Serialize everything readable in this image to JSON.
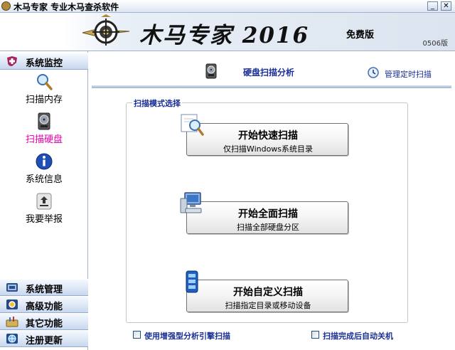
{
  "window": {
    "title": "木马专家  专业木马查杀软件",
    "controls": {
      "minimize": "_",
      "close": "✕"
    }
  },
  "banner": {
    "brand": "木马专家 2016",
    "edition": "免费版",
    "version": "0506版"
  },
  "sidebar": {
    "groups": [
      {
        "label": "系统监控",
        "icon": "shield-cross-icon",
        "expanded": true
      },
      {
        "label": "系统管理",
        "icon": "system-manage-icon"
      },
      {
        "label": "高级功能",
        "icon": "advanced-gear-icon"
      },
      {
        "label": "其它功能",
        "icon": "toolbox-icon"
      },
      {
        "label": "注册更新",
        "icon": "globe-icon"
      }
    ],
    "items": [
      {
        "label": "扫描内存",
        "icon": "magnifier-icon",
        "active": false
      },
      {
        "label": "扫描硬盘",
        "icon": "hard-disk-icon",
        "active": true
      },
      {
        "label": "系统信息",
        "icon": "info-icon",
        "active": false
      },
      {
        "label": "我要举报",
        "icon": "report-upload-icon",
        "active": false
      }
    ]
  },
  "main": {
    "header_title": "硬盘扫描分析",
    "schedule_link": "管理定时扫描",
    "mode_group_label": "扫描模式选择",
    "buttons": [
      {
        "title": "开始快速扫描",
        "subtitle": "仅扫描Windows系统目录",
        "icon": "quick-scan-magnifier-icon"
      },
      {
        "title": "开始全面扫描",
        "subtitle": "扫描全部硬盘分区",
        "icon": "computer-icon"
      },
      {
        "title": "开始自定义扫描",
        "subtitle": "扫描指定目录或移动设备",
        "icon": "custom-scan-drive-icon"
      }
    ],
    "options": [
      {
        "label": "使用增强型分析引擎扫描",
        "checked": false
      },
      {
        "label": "扫描完成后自动关机",
        "checked": false
      }
    ]
  },
  "colors": {
    "accent_blue": "#1a2f96",
    "active_nav": "#e000a8",
    "sidebar_header": "#c9d8ee"
  }
}
